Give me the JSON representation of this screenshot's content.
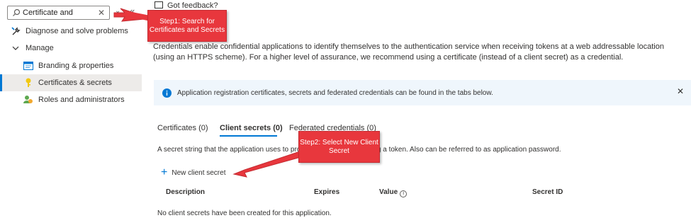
{
  "sidebar": {
    "search": {
      "value": "Certificate and"
    },
    "items": [
      {
        "label": "Diagnose and solve problems",
        "icon": "wrench-icon"
      },
      {
        "label": "Manage",
        "icon": "chevron-down-icon"
      },
      {
        "label": "Branding & properties",
        "icon": "branding-icon"
      },
      {
        "label": "Certificates & secrets",
        "icon": "key-icon",
        "active": true
      },
      {
        "label": "Roles and administrators",
        "icon": "roles-icon"
      }
    ]
  },
  "header": {
    "feedback_label": "Got feedback?"
  },
  "main": {
    "description": "Credentials enable confidential applications to identify themselves to the authentication service when receiving tokens at a web addressable location (using an HTTPS scheme). For a higher level of assurance, we recommend using a certificate (instead of a client secret) as a credential.",
    "info_banner": "Application registration certificates, secrets and federated credentials can be found in the tabs below.",
    "tabs": [
      {
        "label": "Certificates (0)"
      },
      {
        "label": "Client secrets (0)",
        "selected": true
      },
      {
        "label": "Federated credentials (0)"
      }
    ],
    "secret_description_start": "A secret string that the application uses to pro",
    "secret_description_end": "sting a token. Also can be referred to as application password.",
    "new_secret_label": "New client secret",
    "table_headers": [
      "Description",
      "Expires",
      "Value",
      "Secret ID"
    ],
    "empty_message": "No client secrets have been created for this application."
  },
  "annotations": {
    "step1": "Step1: Search for Certificates and Secrets",
    "step2": "Step2: Select New Client Secret"
  },
  "colors": {
    "accent": "#0078d4",
    "callout": "#e8373d",
    "info_bg": "#eff6fc",
    "active_bg": "#edebe9"
  }
}
